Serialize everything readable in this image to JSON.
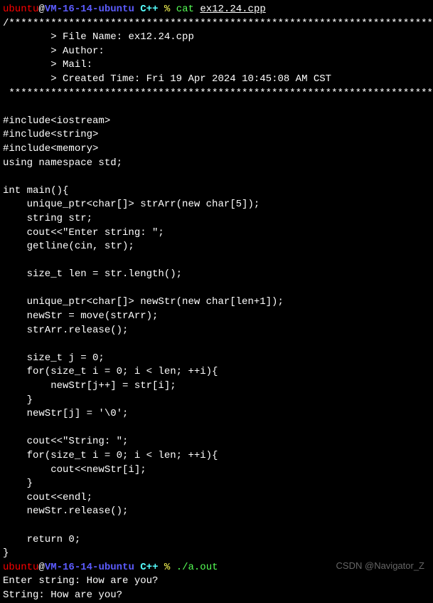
{
  "prompt1": {
    "user": "ubuntu",
    "at": "@",
    "host": "VM-16-14-ubuntu",
    "dir": "C++",
    "percent": "%",
    "cmd": "cat",
    "arg": "ex12.24.cpp"
  },
  "header": {
    "topline": "/*************************************************************************",
    "filename_label": "        > File Name: ",
    "filename_value": "ex12.24.cpp",
    "author_label": "        > Author:",
    "mail_label": "        > Mail:",
    "created_label": "        > Created Time: ",
    "created_value": "Fri 19 Apr 2024 10:45:08 AM CST",
    "botline": " ************************************************************************/"
  },
  "code": {
    "blank": "",
    "l1": "#include<iostream>",
    "l2": "#include<string>",
    "l3": "#include<memory>",
    "l4": "using namespace std;",
    "l5": "int main(){",
    "l6": "    unique_ptr<char[]> strArr(new char[5]);",
    "l7": "    string str;",
    "l8": "    cout<<\"Enter string: \";",
    "l9": "    getline(cin, str);",
    "l10": "    size_t len = str.length();",
    "l11": "    unique_ptr<char[]> newStr(new char[len+1]);",
    "l12": "    newStr = move(strArr);",
    "l13": "    strArr.release();",
    "l14": "    size_t j = 0;",
    "l15": "    for(size_t i = 0; i < len; ++i){",
    "l16": "        newStr[j++] = str[i];",
    "l17": "    }",
    "l18": "    newStr[j] = '\\0';",
    "l19": "    cout<<\"String: \";",
    "l20": "    for(size_t i = 0; i < len; ++i){",
    "l21": "        cout<<newStr[i];",
    "l22": "    }",
    "l23": "    cout<<endl;",
    "l24": "    newStr.release();",
    "l25": "    return 0;",
    "l26": "}"
  },
  "prompt2": {
    "user": "ubuntu",
    "at": "@",
    "host": "VM-16-14-ubuntu",
    "dir": "C++",
    "percent": "%",
    "cmd": "./a.out"
  },
  "output": {
    "line1": "Enter string: How are you?",
    "line2": "String: How are you?"
  },
  "watermark": "CSDN @Navigator_Z"
}
